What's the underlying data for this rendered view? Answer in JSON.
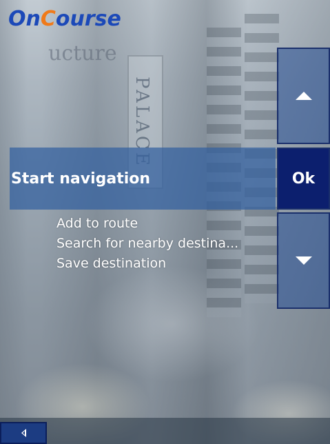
{
  "app": {
    "logo_on": "On",
    "logo_c": "C",
    "logo_rest": "ourse"
  },
  "menu": {
    "selected_label": "Start navigation",
    "ok_label": "Ok",
    "items": [
      "Add to route",
      "Search for nearby destina...",
      "Save destination"
    ]
  },
  "icons": {
    "scroll_up": "triangle-up",
    "scroll_down": "triangle-down",
    "back": "triangle-left"
  },
  "colors": {
    "brand_blue": "#1c49b8",
    "brand_orange": "#f07a1a",
    "ok_button": "#0c1f6e",
    "selected_row": "#325fa0"
  }
}
